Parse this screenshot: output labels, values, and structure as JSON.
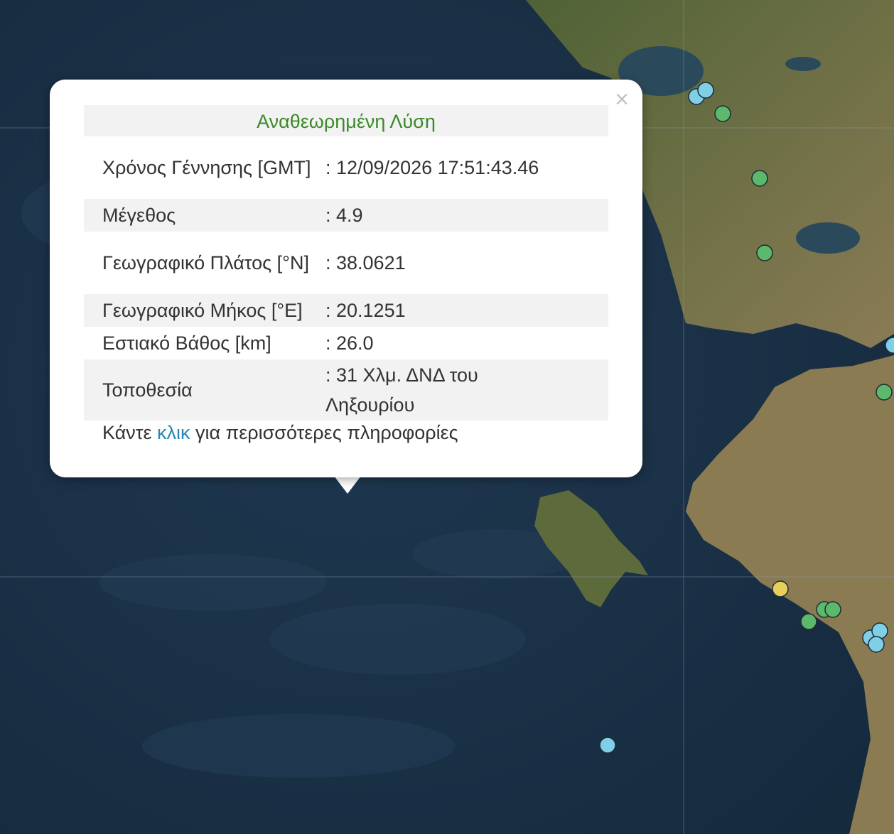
{
  "popup": {
    "close_symbol": "×",
    "title": "Αναθεωρημένη Λύση",
    "rows": [
      {
        "label": "Χρόνος Γέννησης [GMT]",
        "value": ": 12/09/2026 17:51:43.46"
      },
      {
        "label": "Μέγεθος",
        "value": ": 4.9"
      },
      {
        "label": "Γεωγραφικό Πλάτος [°N]",
        "value": ": 38.0621"
      },
      {
        "label": "Γεωγραφικό Μήκος [°E]",
        "value": ": 20.1251"
      },
      {
        "label": "Εστιακό Βάθος [km]",
        "value": ": 26.0"
      },
      {
        "label": "Τοποθεσία",
        "value": ": 31 Χλμ. ΔΝΔ του Ληξουρίου"
      }
    ],
    "more_info": {
      "before": "Κάντε ",
      "link": "κλικ",
      "after": " για περισσότερες πληροφορίες"
    }
  },
  "map": {
    "colors": {
      "sea": "#1d3349",
      "land": "#5b6a3c",
      "title_green": "#3a8a28",
      "link_blue": "#2a86b7",
      "marker_cyan": "#7fd0e6",
      "marker_green": "#5cb86a",
      "marker_yellow": "#e6cf5a"
    },
    "markers": [
      "marker_cyan",
      "marker_cyan",
      "marker_green",
      "marker_green",
      "marker_green",
      "marker_cyan",
      "marker_green",
      "marker_yellow",
      "marker_green",
      "marker_green",
      "marker_green",
      "marker_cyan",
      "marker_cyan",
      "marker_cyan",
      "marker_cyan"
    ]
  }
}
